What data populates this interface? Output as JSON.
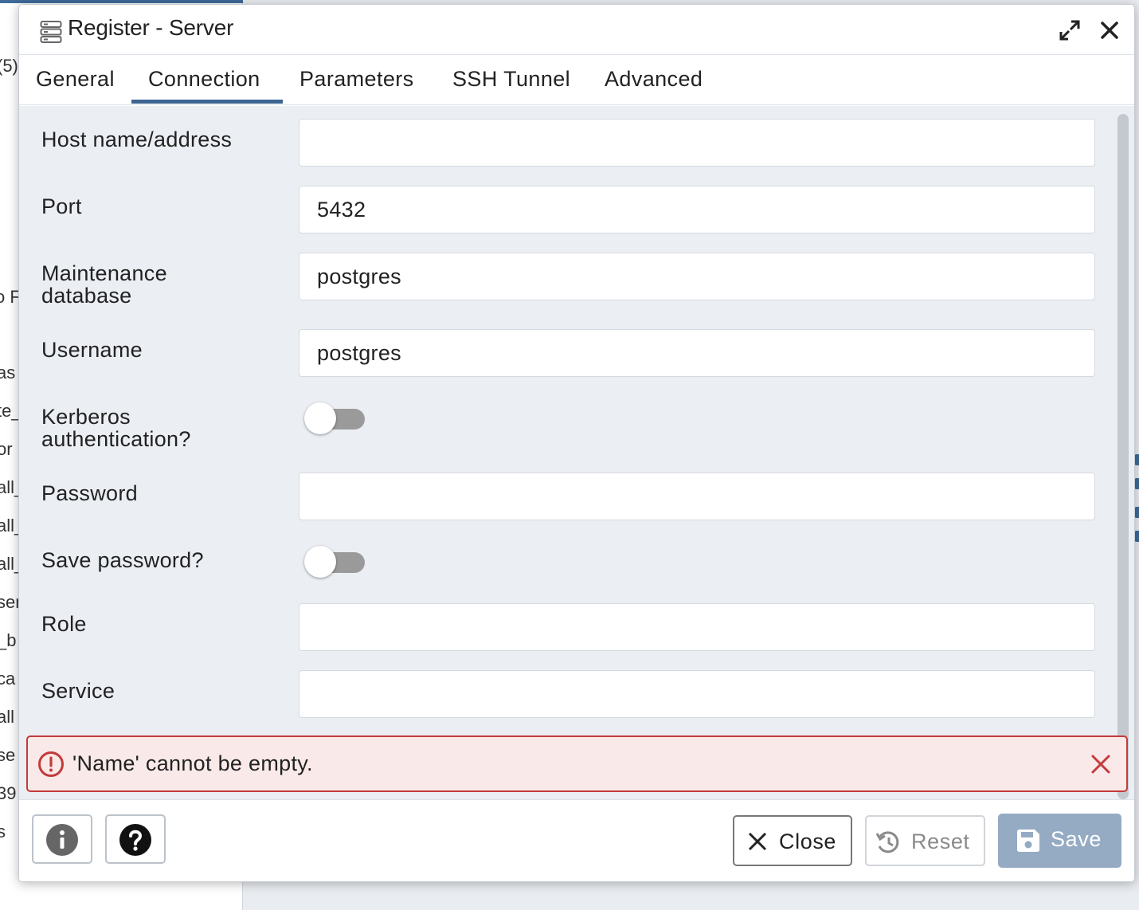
{
  "background": {
    "left_fragments": [
      "(5)",
      "o F",
      "as",
      "te_",
      "or",
      "all_",
      "all_",
      "all_",
      "ser",
      "_b",
      "ca",
      "all",
      "se",
      "39",
      "s"
    ]
  },
  "dialog": {
    "title": "Register - Server",
    "icons": {
      "title": "server-icon",
      "maximize": "expand-arrows-icon",
      "close": "close-x-icon"
    }
  },
  "tabs": [
    {
      "label": "General"
    },
    {
      "label": "Connection",
      "active": true
    },
    {
      "label": "Parameters"
    },
    {
      "label": "SSH Tunnel"
    },
    {
      "label": "Advanced"
    }
  ],
  "form": {
    "host": {
      "label": "Host name/address",
      "value": ""
    },
    "port": {
      "label": "Port",
      "value": "5432"
    },
    "maintenance_db": {
      "label_line1": "Maintenance",
      "label_line2": "database",
      "value": "postgres"
    },
    "username": {
      "label": "Username",
      "value": "postgres"
    },
    "kerberos": {
      "label_line1": "Kerberos",
      "label_line2": "authentication?",
      "enabled": false
    },
    "password": {
      "label": "Password",
      "value": ""
    },
    "save_password": {
      "label": "Save password?",
      "enabled": false
    },
    "role": {
      "label": "Role",
      "value": ""
    },
    "service": {
      "label": "Service",
      "value": ""
    }
  },
  "error": {
    "message": "'Name' cannot be empty.",
    "icon": "alert-circle-icon"
  },
  "footer": {
    "info_icon": "info-icon",
    "help_icon": "help-icon",
    "close_label": "Close",
    "reset_label": "Reset",
    "save_label": "Save"
  },
  "colors": {
    "accent": "#3c6592",
    "error_border": "#c43a3a",
    "error_bg": "#f9e9e9",
    "save_button": "#95abc4"
  }
}
